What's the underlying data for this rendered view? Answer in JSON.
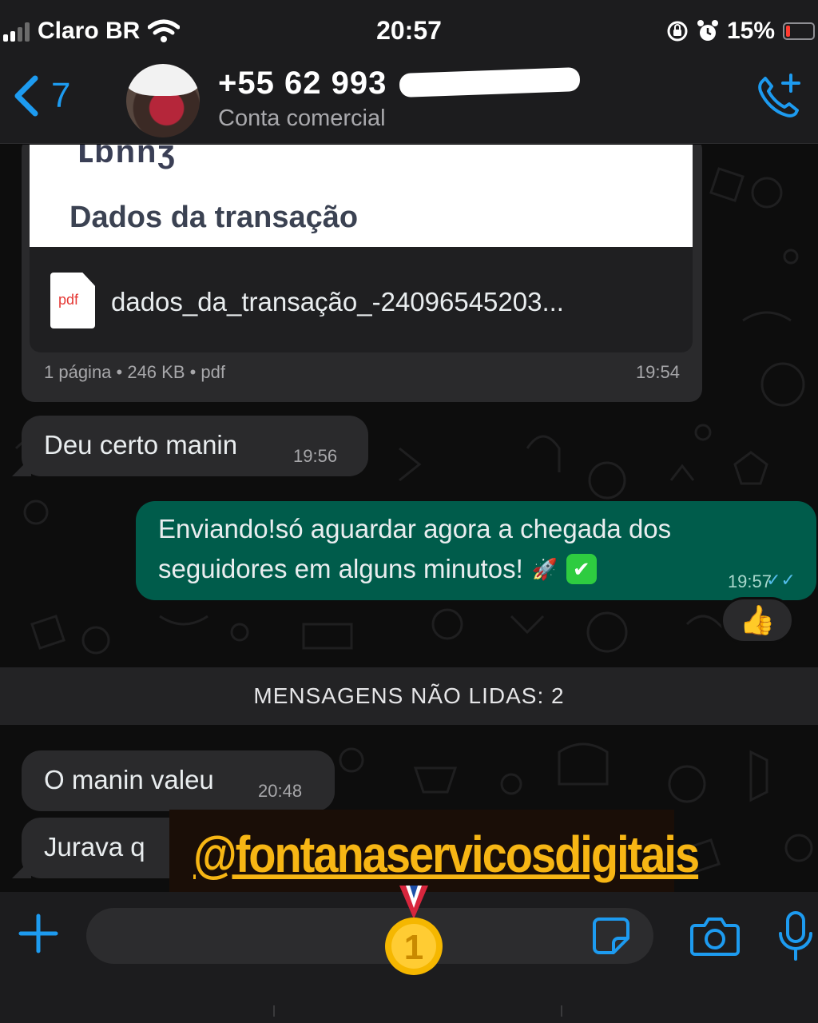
{
  "status_bar": {
    "carrier": "Claro BR",
    "time": "20:57",
    "battery_percent": "15%",
    "battery_level": 0.15,
    "icons": [
      "signal-icon",
      "wifi-icon",
      "orientation-lock-icon",
      "alarm-icon",
      "battery-icon"
    ]
  },
  "header": {
    "back_count": "7",
    "title": "+55 62 993",
    "subtitle": "Conta comercial",
    "icons": [
      "back-chevron-icon",
      "add-call-icon"
    ]
  },
  "messages": {
    "document": {
      "preview_heading": "Dados da transação",
      "file_type_label": "pdf",
      "file_name": "dados_da_transação_-24096545203...",
      "meta": "1 página • 246 KB • pdf",
      "time": "19:54"
    },
    "incoming_1": {
      "text": "Deu certo manin",
      "time": "19:56"
    },
    "outgoing_1": {
      "line1": "Enviando!só aguardar agora a chegada dos",
      "line2": "seguidores em alguns minutos!",
      "emoji_1": "🚀",
      "emoji_2": "✔",
      "time": "19:57",
      "read_ticks": "✓✓",
      "reaction": "👍"
    },
    "unread_divider": "MENSAGENS NÃO LIDAS: 2",
    "incoming_2": {
      "text": "O manin valeu",
      "time": "20:48"
    },
    "incoming_3": {
      "text": "Jurava q"
    }
  },
  "overlay": {
    "watermark": "@fontanaservicosdigitais",
    "medal_number": "1"
  },
  "input_bar": {
    "icons": [
      "plus-icon",
      "sticker-icon",
      "camera-icon",
      "microphone-icon"
    ]
  },
  "colors": {
    "accent": "#1d9bf0",
    "outgoing_bubble": "#005c4b",
    "incoming_bubble": "#2a2a2c",
    "watermark": "#f7b614",
    "battery_low": "#ff3b30"
  }
}
